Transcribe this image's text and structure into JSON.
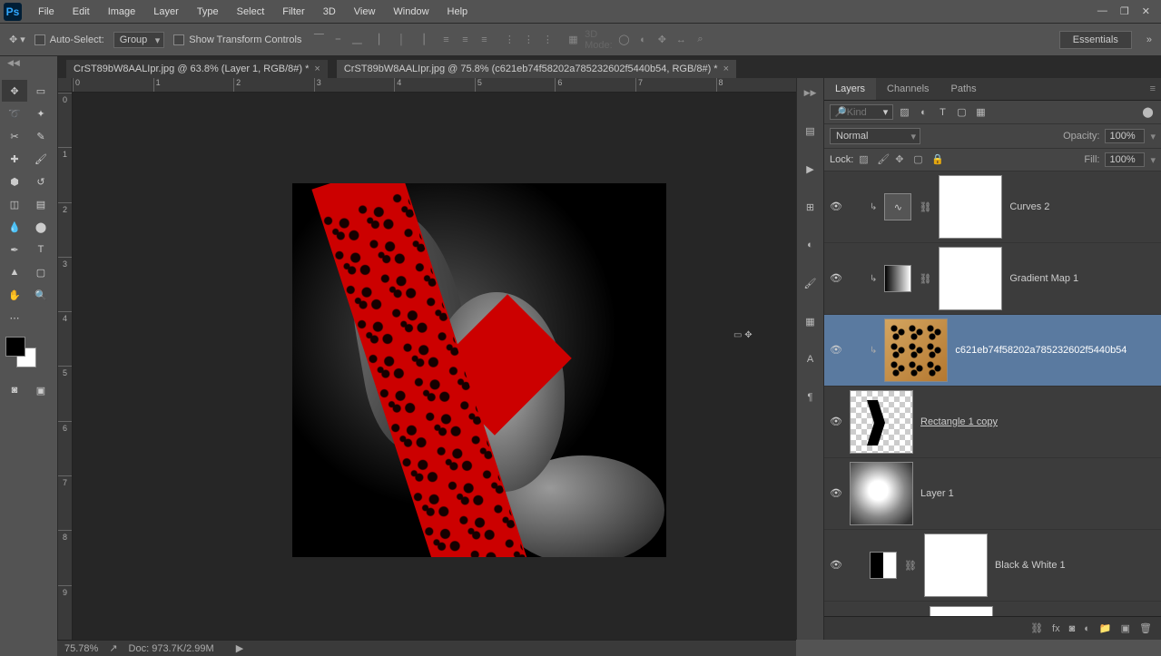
{
  "menu": {
    "items": [
      "File",
      "Edit",
      "Image",
      "Layer",
      "Type",
      "Select",
      "Filter",
      "3D",
      "View",
      "Window",
      "Help"
    ]
  },
  "options": {
    "auto_select_label": "Auto-Select:",
    "group_label": "Group",
    "show_transform_label": "Show Transform Controls",
    "threed_mode_label": "3D Mode:",
    "essentials_label": "Essentials"
  },
  "tabs": [
    {
      "label": "CrST89bW8AALIpr.jpg @ 63.8% (Layer 1, RGB/8#) *",
      "active": false
    },
    {
      "label": "CrST89bW8AALIpr.jpg @ 75.8% (c621eb74f58202a785232602f5440b54, RGB/8#) *",
      "active": true
    }
  ],
  "ruler_h": [
    "0",
    "1",
    "2",
    "3",
    "4",
    "5",
    "6",
    "7",
    "8"
  ],
  "ruler_v": [
    "0",
    "1",
    "2",
    "3",
    "4",
    "5",
    "6",
    "7",
    "8",
    "9"
  ],
  "panels": {
    "tabs": [
      "Layers",
      "Channels",
      "Paths"
    ],
    "kind_placeholder": "Kind",
    "blend": "Normal",
    "opacity_label": "Opacity:",
    "opacity_value": "100%",
    "fill_label": "Fill:",
    "fill_value": "100%",
    "lock_label": "Lock:"
  },
  "layers": [
    {
      "name": "Curves 2",
      "type": "adj",
      "clip": true
    },
    {
      "name": "Gradient Map 1",
      "type": "adj",
      "clip": true
    },
    {
      "name": "c621eb74f58202a785232602f5440b54",
      "type": "leopard",
      "selected": true,
      "clip": true
    },
    {
      "name": "Rectangle 1 copy",
      "type": "arrow",
      "underline": true,
      "smart": true
    },
    {
      "name": "Layer 1",
      "type": "blur"
    },
    {
      "name": "Black & White 1",
      "type": "adj-bw"
    }
  ],
  "status": {
    "zoom": "75.78%",
    "doc": "Doc: 973.7K/2.99M"
  }
}
